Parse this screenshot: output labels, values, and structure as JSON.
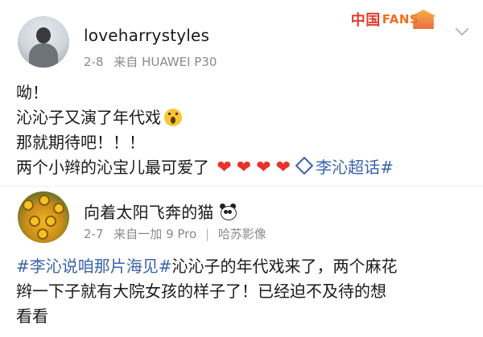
{
  "post_1": {
    "username": "loveharrystyles",
    "date": "2-8",
    "source_prefix": "来自",
    "device": "HUAWEI P30",
    "badge": {
      "main": "中国",
      "sub": "FANS"
    },
    "lines": [
      "呦！",
      "沁沁子又演了年代戏",
      "那就期待吧！！！",
      "两个小辫的沁宝儿最可爱了"
    ],
    "topic": "李沁超话#"
  },
  "post_2": {
    "username": "向着太阳飞奔的猫",
    "date": "2-7",
    "source_prefix": "来自",
    "device": "一加 9 Pro",
    "separator": "|",
    "app": "哈苏影像",
    "topic": "#李沁说咱那片海见#",
    "line_1_rest": "沁沁子的年代戏来了，两个麻花",
    "line_2": "辫一下子就有大院女孩的样子了！已经迫不及待的想",
    "line_3": "看看"
  },
  "colors": {
    "topic": "#3a63a9",
    "heart": "#e8322a",
    "meta": "#8a8a8a"
  },
  "icons": [
    "chevron-down-icon",
    "scream-emoji-icon",
    "heart-icon",
    "diamond-topic-icon",
    "panda-emoji-icon"
  ]
}
